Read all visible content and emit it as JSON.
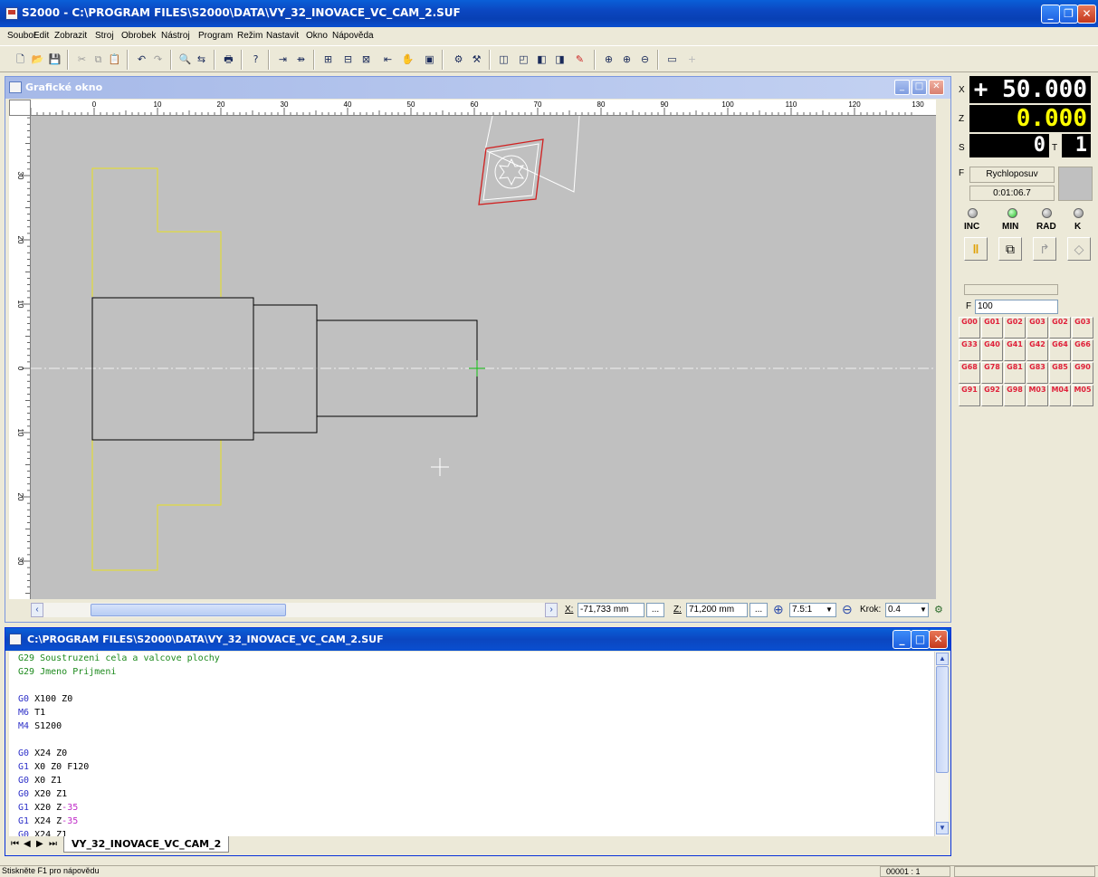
{
  "window": {
    "title": "S2000 - C:\\PROGRAM FILES\\S2000\\DATA\\VY_32_INOVACE_VC_CAM_2.SUF"
  },
  "menu": [
    "Soubor",
    "Edit",
    "Zobrazit",
    "Stroj",
    "Obrobek",
    "Nástroj",
    "Program",
    "Režim",
    "Nastavit",
    "Okno",
    "Nápověda"
  ],
  "graphic": {
    "title": "Grafické okno",
    "ruler_h": [
      "0",
      "10",
      "20",
      "30",
      "40",
      "50",
      "60",
      "70",
      "80",
      "90",
      "100",
      "110",
      "120",
      "130"
    ],
    "ruler_v": [
      "30",
      "20",
      "10",
      "0",
      "10",
      "20",
      "30"
    ],
    "x_label": "X:",
    "x_value": "-71,733 mm",
    "z_label": "Z:",
    "z_value": "71,200 mm",
    "zoom": "7.5:1",
    "step_label": "Krok:",
    "step_value": "0.4",
    "ellipsis": "..."
  },
  "readout": {
    "x_label": "X",
    "x_value": "+ 50.000",
    "z_label": "Z",
    "z_value": "0.000",
    "s_label": "S",
    "s_value": "0",
    "t_label": "T",
    "t_value": "1",
    "f_label": "F",
    "f_mode": "Rychloposuv",
    "time": "0:01:06.7",
    "modes": [
      "INC",
      "MIN",
      "RAD",
      "K"
    ],
    "feed_label": "F",
    "feed_value": "100"
  },
  "gcodes": [
    [
      "G00",
      "G01",
      "G02",
      "G03",
      "G02",
      "G03"
    ],
    [
      "G33",
      "G40",
      "G41",
      "G42",
      "G64",
      "G66"
    ],
    [
      "G68",
      "G78",
      "G81",
      "G83",
      "G85",
      "G90"
    ],
    [
      "G91",
      "G92",
      "G98",
      "M03",
      "M04",
      "M05"
    ]
  ],
  "editor": {
    "title": "C:\\PROGRAM FILES\\S2000\\DATA\\VY_32_INOVACE_VC_CAM_2.SUF",
    "tab": "VY_32_INOVACE_VC_CAM_2",
    "lines": [
      [
        {
          "c": "cmt",
          "t": "G29 Soustruzeni cela a valcove plochy"
        }
      ],
      [
        {
          "c": "cmt",
          "t": "G29 Jmeno Prijmeni"
        }
      ],
      [],
      [
        {
          "c": "kg",
          "t": "G0"
        },
        {
          "c": "",
          "t": " X100 Z0"
        }
      ],
      [
        {
          "c": "km",
          "t": "M6"
        },
        {
          "c": "",
          "t": " T1"
        }
      ],
      [
        {
          "c": "km",
          "t": "M4"
        },
        {
          "c": "",
          "t": " S1200"
        }
      ],
      [],
      [
        {
          "c": "kg",
          "t": "G0"
        },
        {
          "c": "",
          "t": " X24 Z0"
        }
      ],
      [
        {
          "c": "kg",
          "t": "G1"
        },
        {
          "c": "",
          "t": " X0 Z0 F120"
        }
      ],
      [
        {
          "c": "kg",
          "t": "G0"
        },
        {
          "c": "",
          "t": " X0 Z1"
        }
      ],
      [
        {
          "c": "kg",
          "t": "G0"
        },
        {
          "c": "",
          "t": " X20 Z1"
        }
      ],
      [
        {
          "c": "kg",
          "t": "G1"
        },
        {
          "c": "",
          "t": " X20 Z"
        },
        {
          "c": "neg",
          "t": "-35"
        }
      ],
      [
        {
          "c": "kg",
          "t": "G1"
        },
        {
          "c": "",
          "t": " X24 Z"
        },
        {
          "c": "neg",
          "t": "-35"
        }
      ],
      [
        {
          "c": "kg",
          "t": "G0"
        },
        {
          "c": "",
          "t": " X24 Z1"
        }
      ]
    ]
  },
  "status": {
    "help": "Stiskněte F1 pro nápovědu",
    "pos": "00001 : 1"
  }
}
